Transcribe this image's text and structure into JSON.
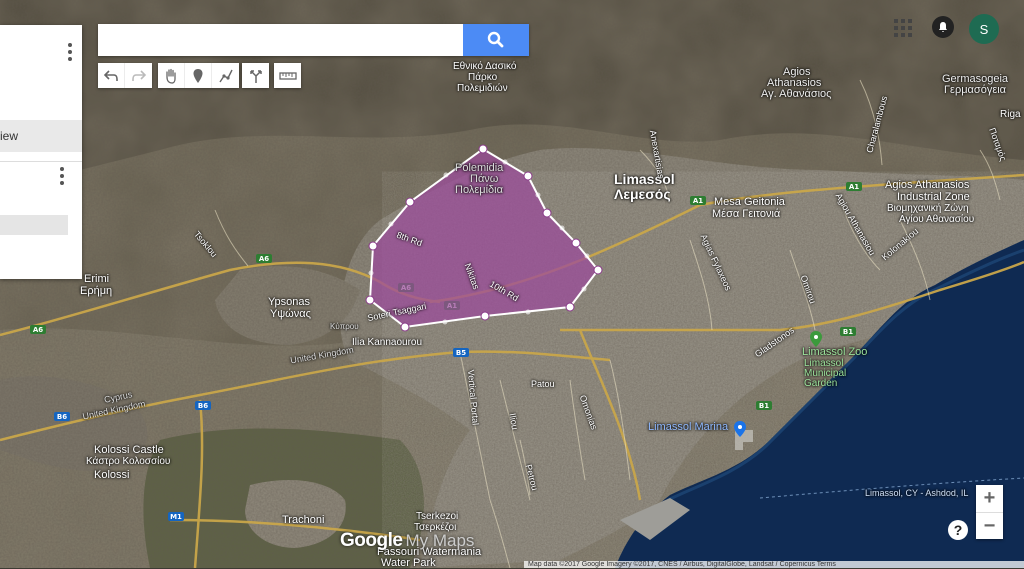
{
  "search": {
    "placeholder": ""
  },
  "toolbar": {
    "undo_icon": "undo-icon",
    "redo_icon": "redo-icon",
    "pan_icon": "hand-icon",
    "marker_icon": "marker-icon",
    "line_icon": "draw-line-icon",
    "directions_icon": "directions-icon",
    "ruler_icon": "ruler-icon"
  },
  "panel": {
    "view_label": "iew"
  },
  "user": {
    "initial": "S"
  },
  "zoom": {
    "in": "+",
    "out": "−"
  },
  "help": "?",
  "branding": {
    "google": "Google",
    "mymaps": "My Maps"
  },
  "attribution": "Map data ©2017 Google Imagery ©2017, CNES / Airbus, DigitalGlobe, Landsat / Copernicus Terms",
  "map_labels": {
    "ethniko": "Εθνικό Δασικό",
    "parko": "Πάρκο",
    "polemidion": "Πολεμιδιών",
    "agios": "Agios",
    "athanasios": "Athanasios",
    "ag_athanasios": "Αγ. Αθανάσιος",
    "germasogeia": "Germasogeia",
    "germasogeia_gr": "Γερμασόγεια",
    "limassol": "Limassol",
    "lemesos": "Λεμεσός",
    "mesa_geitonia": "Mesa Geitonia",
    "mesa_geitonia_gr": "Μέσα Γειτονιά",
    "industrial_1": "Agios Athanasios",
    "industrial_2": "Industrial Zone",
    "industrial_3": "Βιομηχανική Ζώνη",
    "industrial_4": "Αγίου Αθανασίου",
    "pano_1": "Polemidia",
    "pano_2": "Πάνω",
    "pano_3": "Πολεμίδια",
    "erimi": "Erimi",
    "erimi_gr": "Ερήμη",
    "ypsonas": "Ypsonas",
    "ypsonas_gr": "Υψώνας",
    "kannaourou": "Ilia Kannaourou",
    "united_kingdom": "United Kingdom",
    "cyprus": "Cyprus",
    "united_kingdom_2": "United Kingdom",
    "kolossi_castle": "Kolossi Castle",
    "kolossi_castle_gr": "Κάστρο Κολοσσίου",
    "kolossi": "Kolossi",
    "trachoni": "Trachoni",
    "tserkezoi": "Tserkezoi",
    "tserkezoi_gr": "Τσερκέζοι",
    "fassouri_1": "Fassouri Watermania",
    "fassouri_2": "Water Park",
    "limassol_zoo": "Limassol Zoo",
    "municipal_1": "Limassol",
    "municipal_2": "Municipal",
    "municipal_3": "Garden",
    "marina": "Limassol Marina",
    "ferry": "Limassol, CY - Ashdod, IL",
    "patou": "Patou",
    "gladstonos": "Gladstonos",
    "kolonakiou": "Kolonakiou",
    "omirou": "Omirou",
    "agias_fylaxeos": "Agias Fylaxeos",
    "anexartisias": "Anexartisias",
    "charalambous": "Charalambous",
    "ayiou_athanasiou": "Agiou Athanasiou",
    "ommonias": "Omonias",
    "vertical_portal": "Vertical Portal",
    "iliou": "Iliou",
    "petrou": "Petrou",
    "tsoklou": "Tsoklou",
    "eighth_rd": "8th Rd",
    "tenth_rd": "10th Rd",
    "nikitas": "Nikitas",
    "soteri": "Soteri Tsaggari",
    "kyprou": "Κύπρου",
    "potamos": "Ποταμός",
    "rigaina": "Riga",
    "a1a": "A1",
    "a1b": "A1",
    "a1c": "A1",
    "a6a": "A6",
    "a6b": "A6",
    "a6c": "A6",
    "b1a": "B1",
    "b1b": "B1",
    "b5": "B5",
    "b6a": "B6",
    "b6b": "B6",
    "m1": "M1"
  },
  "colors": {
    "polygon_fill": "#9b4a9b",
    "polygon_stroke": "#ffffff",
    "sea": "#0f2a52",
    "search_button": "#4c8bf5"
  }
}
